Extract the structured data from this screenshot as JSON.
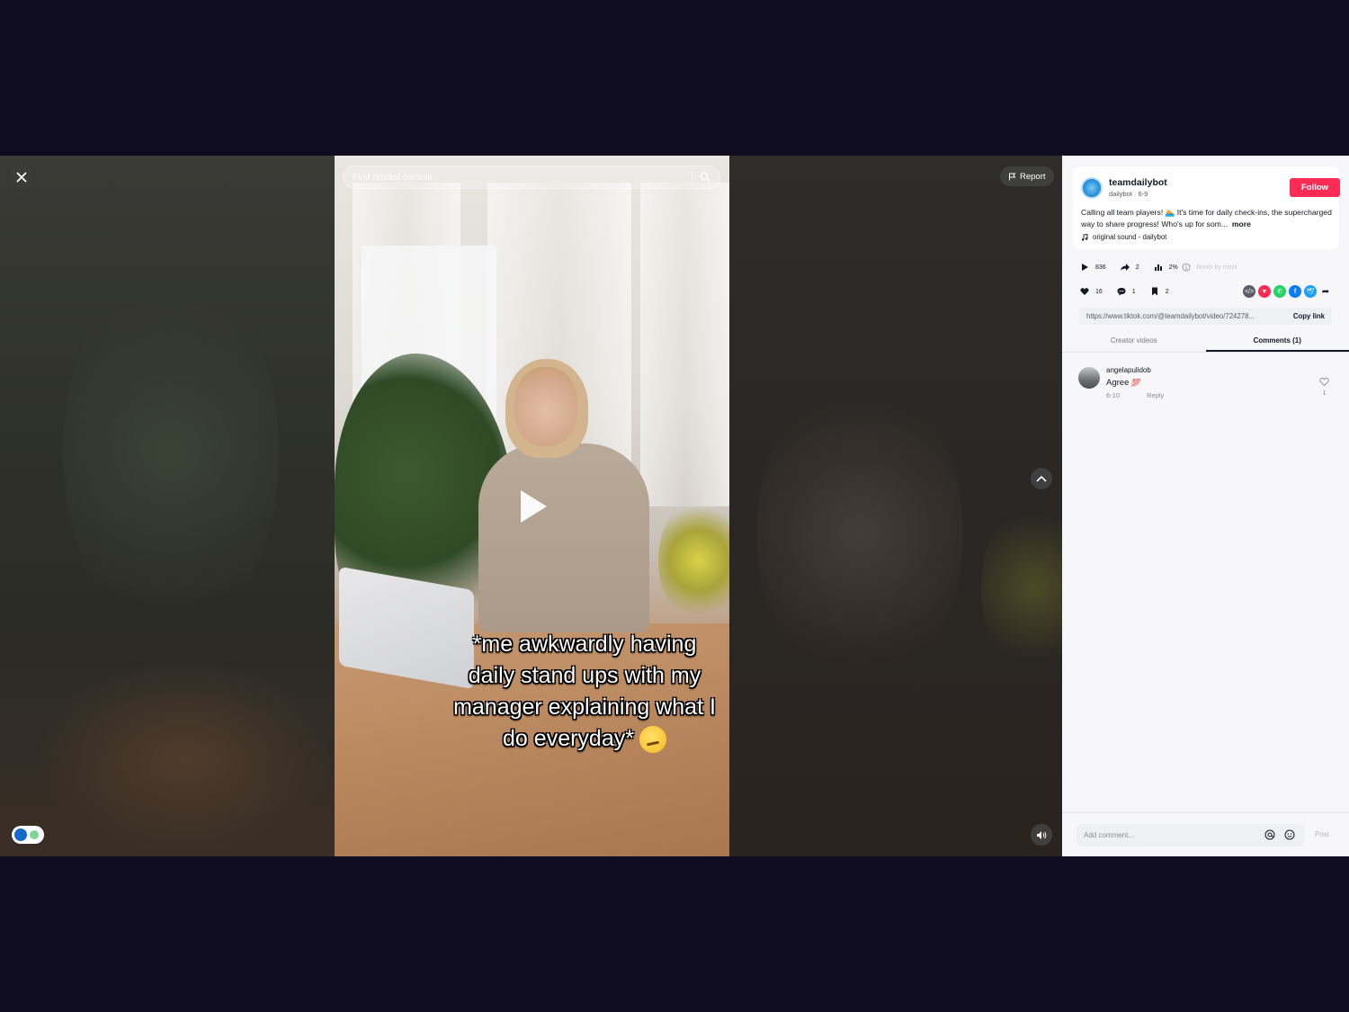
{
  "player": {
    "search_placeholder": "Find related content",
    "report_label": "Report",
    "caption": "*me awkwardly having daily stand ups with my manager explaining what I do everyday*"
  },
  "author": {
    "username": "teamdailybot",
    "subline": "dailybot · 6-9",
    "follow_label": "Follow",
    "description": "Calling all team players! 🏊 It's time for daily check-ins, the supercharged way to share progress! Who's up for som...",
    "more_label": "more",
    "sound": "original sound - dailybot"
  },
  "stats": {
    "plays": "836",
    "shares": "2",
    "engagement": "2%",
    "engagement_note": "Boots by mtrol",
    "likes": "16",
    "comments": "1",
    "saves": "2"
  },
  "share_icons": [
    "embed-icon",
    "tiktok-friends-icon",
    "whatsapp-icon",
    "facebook-icon",
    "twitter-icon",
    "share-arrow-icon"
  ],
  "link": {
    "url": "https://www.tiktok.com/@teamdailybot/video/724278...",
    "copy_label": "Copy link"
  },
  "tabs": {
    "creator_videos": "Creator videos",
    "comments": "Comments (1)"
  },
  "comments": [
    {
      "username": "angelapulidob",
      "text": "Agree",
      "emoji": "💯",
      "date": "6-10",
      "reply_label": "Reply",
      "likes": "1"
    }
  ],
  "composer": {
    "placeholder": "Add comment...",
    "post_label": "Post"
  },
  "colors": {
    "accent": "#fe2c55",
    "background": "#0f0c20"
  }
}
